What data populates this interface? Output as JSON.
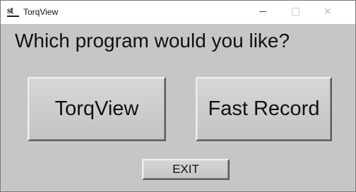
{
  "window": {
    "title": "TorqView",
    "icon": "st-logo-icon",
    "controls": {
      "minimize": "–",
      "maximize": "□",
      "close": "✕"
    }
  },
  "main": {
    "question": "Which program would you like?",
    "buttons": {
      "torqview": "TorqView",
      "fast_record": "Fast Record",
      "exit": "EXIT"
    }
  },
  "colors": {
    "background": "#c6c6c6",
    "titlebar": "#ffffff"
  }
}
